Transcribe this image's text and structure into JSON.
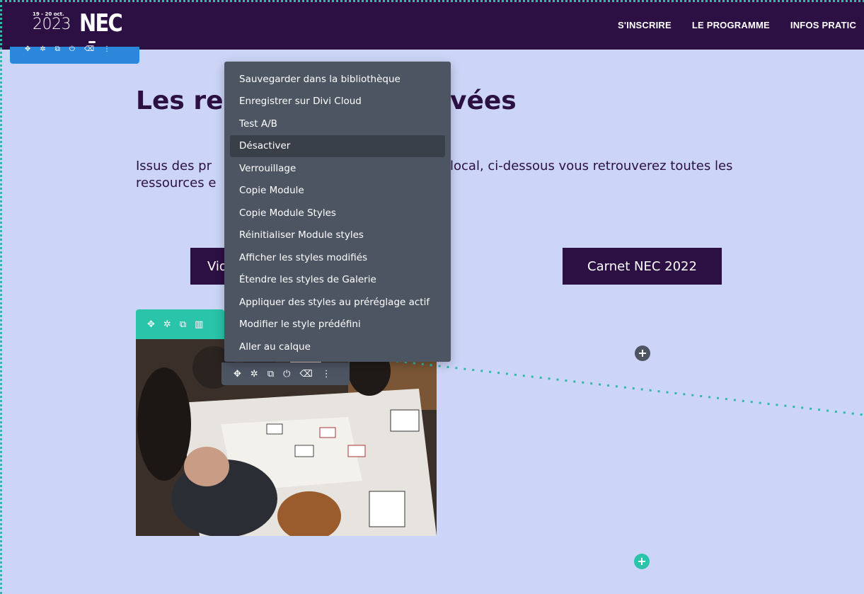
{
  "header": {
    "logo": {
      "date": "19 - 20 oct.",
      "year": "2023",
      "brand": "NEC"
    },
    "nav": [
      "S'INSCRIRE",
      "LE PROGRAMME",
      "INFOS PRATIC"
    ]
  },
  "builder": {
    "section_toolbar_icons": [
      "move-icon",
      "gear-icon",
      "duplicate-icon",
      "power-icon",
      "trash-icon",
      "more-icon"
    ],
    "module_toolbar_icons": [
      "move-icon",
      "gear-icon",
      "duplicate-icon",
      "columns-icon"
    ],
    "row_toolbar_icons": [
      "move-icon",
      "gear-icon",
      "duplicate-icon",
      "power-icon",
      "trash-icon",
      "more-icon"
    ],
    "add_buttons": [
      "+",
      "+"
    ]
  },
  "content": {
    "title_left": "Les re",
    "title_right": "vées",
    "paragraph_line1_left": "Issus des pr",
    "paragraph_line1_right": "local, ci-dessous vous retrouverez toutes les",
    "paragraph_line2_left": "ressources e",
    "button_left": "Vid",
    "button_right": "Carnet NEC 2022"
  },
  "context_menu": {
    "items": [
      "Sauvegarder dans la bibliothèque",
      "Enregistrer sur Divi Cloud",
      "Test A/B",
      "Désactiver",
      "Verrouillage",
      "Copie Module",
      "Copie Module Styles",
      "Réinitialiser Module styles",
      "Afficher les styles modifiés",
      "Étendre les styles de Galerie",
      "Appliquer des styles au préréglage actif",
      "Modifier le style prédéfini",
      "Aller au calque"
    ],
    "highlighted_index": 3
  },
  "colors": {
    "header_bg": "#2c1044",
    "page_bg": "#ccd5f7",
    "builder_blue": "#2b87da",
    "builder_green": "#29c4a9",
    "builder_gray": "#4d5563"
  }
}
